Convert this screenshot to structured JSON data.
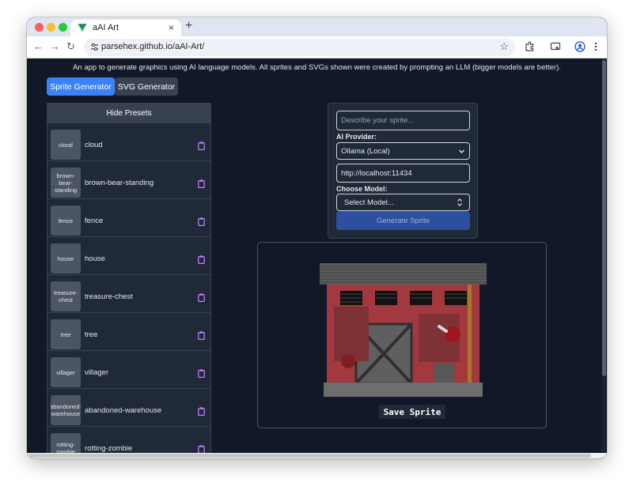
{
  "browser": {
    "tab_title": "aAI Art",
    "tab_close": "×",
    "new_tab": "+",
    "url": "parsehex.github.io/aAI-Art/",
    "back": "←",
    "forward": "→",
    "reload": "↻",
    "star": "☆"
  },
  "page": {
    "intro": "An app to generate graphics using AI language models. All sprites and SVGs shown were created by prompting an LLM (bigger models are better).",
    "modes": [
      {
        "label": "Sprite Generator",
        "active": true
      },
      {
        "label": "SVG Generator",
        "active": false
      }
    ]
  },
  "presets": {
    "toggle_label": "Hide Presets",
    "items": [
      {
        "thumb": "cloud",
        "name": "cloud"
      },
      {
        "thumb": "brown-bear-standing",
        "name": "brown-bear-standing"
      },
      {
        "thumb": "fence",
        "name": "fence"
      },
      {
        "thumb": "house",
        "name": "house"
      },
      {
        "thumb": "treasure-chest",
        "name": "treasure-chest"
      },
      {
        "thumb": "tree",
        "name": "tree"
      },
      {
        "thumb": "villager",
        "name": "villager"
      },
      {
        "thumb": "abandoned-warehouse",
        "name": "abandoned-warehouse"
      },
      {
        "thumb": "rotting-zombie",
        "name": "rotting-zombie"
      }
    ]
  },
  "form": {
    "prompt_placeholder": "Describe your sprite...",
    "provider_label": "AI Provider:",
    "provider_value": "Ollama (Local)",
    "endpoint_value": "http://localhost:11434",
    "model_label": "Choose Model:",
    "model_value": "Select Model...",
    "generate_label": "Generate Sprite"
  },
  "preview": {
    "save_label": "Save Sprite"
  },
  "colors": {
    "accent": "#3b82f6",
    "page_bg": "#111827",
    "panel_bg": "#1f2937",
    "clipboard": "#c084fc"
  }
}
